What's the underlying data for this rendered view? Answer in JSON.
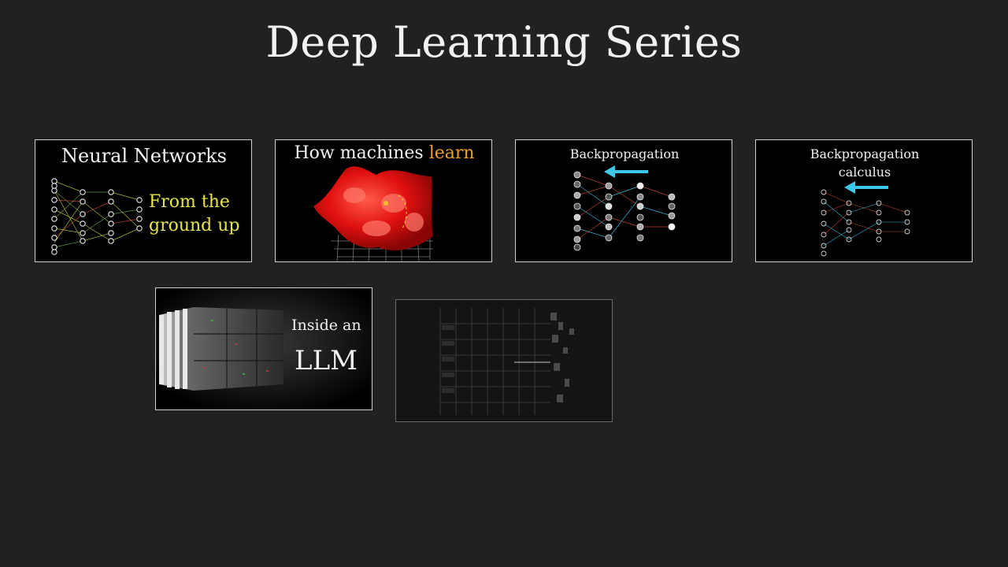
{
  "page": {
    "title": "Deep Learning Series"
  },
  "cards": [
    {
      "title": "Neural Networks",
      "subtitle_line1": "From the",
      "subtitle_line2": "ground up"
    },
    {
      "title_prefix": "How machines ",
      "title_highlight": "learn"
    },
    {
      "title": "Backpropagation"
    },
    {
      "title_line1": "Backpropagation",
      "title_line2": "calculus"
    },
    {
      "line1": "Inside an",
      "line2": "LLM"
    },
    {}
  ],
  "colors": {
    "background": "#212121",
    "highlight_yellow": "#e6e64a",
    "highlight_orange": "#f0a020",
    "arrow_blue": "#3ec6e8",
    "surface_red": "#e01010"
  }
}
